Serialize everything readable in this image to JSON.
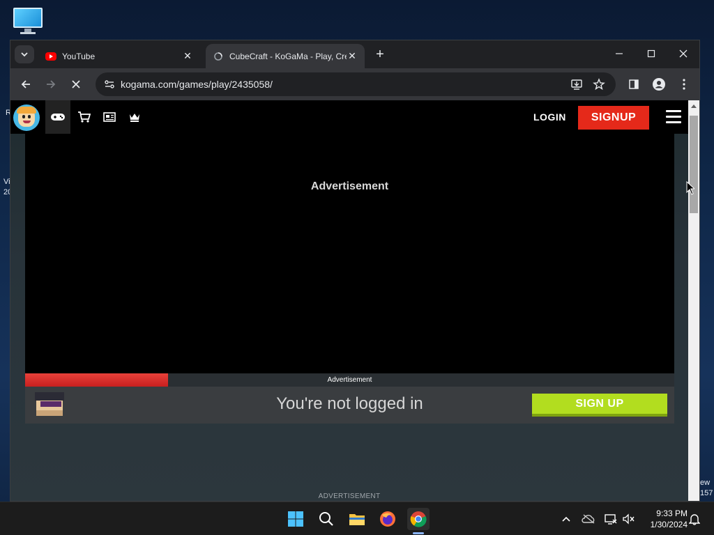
{
  "desktop": {
    "left_fragments": [
      "R",
      "Vi",
      "20"
    ],
    "right_fragments": [
      "ew",
      "157"
    ]
  },
  "browser": {
    "tabs": [
      {
        "title": "YouTube",
        "close": "✕"
      },
      {
        "title": "CubeCraft - KoGaMa - Play, Cre",
        "close": "✕"
      }
    ],
    "new_tab": "+",
    "url": "kogama.com/games/play/2435058/"
  },
  "page": {
    "nav": {
      "login_label": "LOGIN",
      "signup_label": "SIGNUP"
    },
    "ad_title": "Advertisement",
    "progress": {
      "label": "Advertisement",
      "percent": 22
    },
    "login_bar": {
      "message": "You're not logged in",
      "signup_label": "SIGN UP"
    },
    "footer_ad": "ADVERTISEMENT"
  },
  "taskbar": {
    "time": "9:33 PM",
    "date": "1/30/2024"
  },
  "colors": {
    "signup_red": "#e5291a",
    "signup_green": "#b2dd1f",
    "progress_red": "#e8413a"
  }
}
